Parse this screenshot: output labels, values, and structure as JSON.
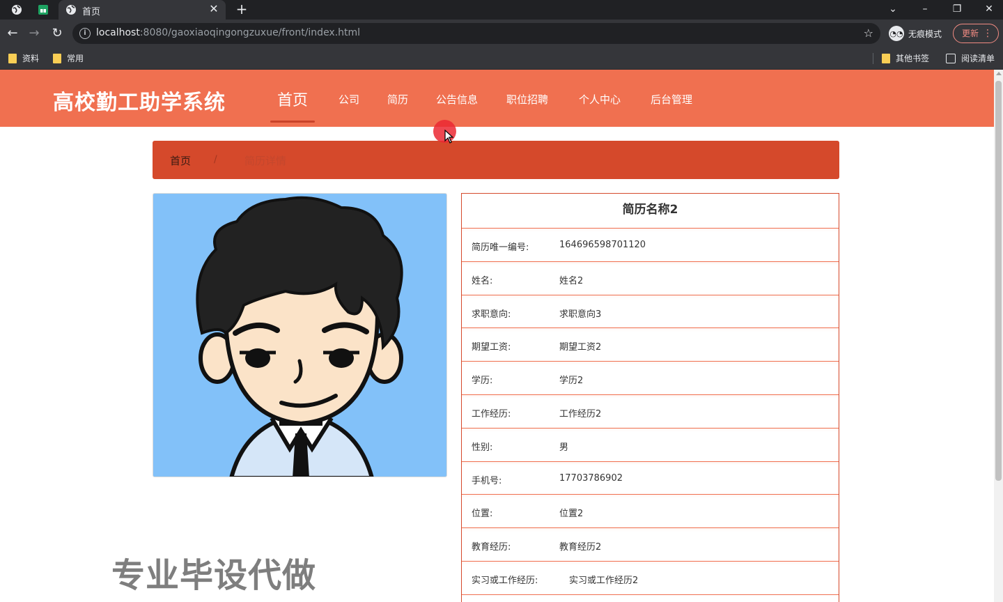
{
  "browser": {
    "tab_title": "首页",
    "url_host": "localhost",
    "url_path": ":8080/gaoxiaoqingongzuxue/front/index.html",
    "incognito_label": "无痕模式",
    "update_label": "更新",
    "bookmarks": [
      "资料",
      "常用"
    ],
    "bookmarks_right": [
      "其他书签",
      "阅读清单"
    ]
  },
  "site": {
    "logo": "高校勤工助学系统",
    "nav": [
      "首页",
      "公司",
      "简历",
      "公告信息",
      "职位招聘",
      "个人中心",
      "后台管理"
    ],
    "active_nav_index": 0,
    "breadcrumb": {
      "home": "首页",
      "separator": "/",
      "current": "简历详情"
    }
  },
  "resume": {
    "title": "简历名称2",
    "fields": [
      {
        "label": "简历唯一编号:",
        "value": "164696598701120"
      },
      {
        "label": "姓名:",
        "value": "姓名2"
      },
      {
        "label": "求职意向:",
        "value": "求职意向3"
      },
      {
        "label": "期望工资:",
        "value": "期望工资2"
      },
      {
        "label": "学历:",
        "value": "学历2"
      },
      {
        "label": "工作经历:",
        "value": "工作经历2"
      },
      {
        "label": "性别:",
        "value": "男"
      },
      {
        "label": "手机号:",
        "value": "17703786902"
      },
      {
        "label": "位置:",
        "value": "位置2"
      },
      {
        "label": "教育经历:",
        "value": "教育经历2"
      },
      {
        "label": "实习或工作经历:",
        "value": "实习或工作经历2"
      }
    ]
  },
  "watermark": "专业毕设代做",
  "colors": {
    "header": "#f07050",
    "breadcrumb": "#d5492b",
    "photo_bg": "#82c1f9"
  }
}
